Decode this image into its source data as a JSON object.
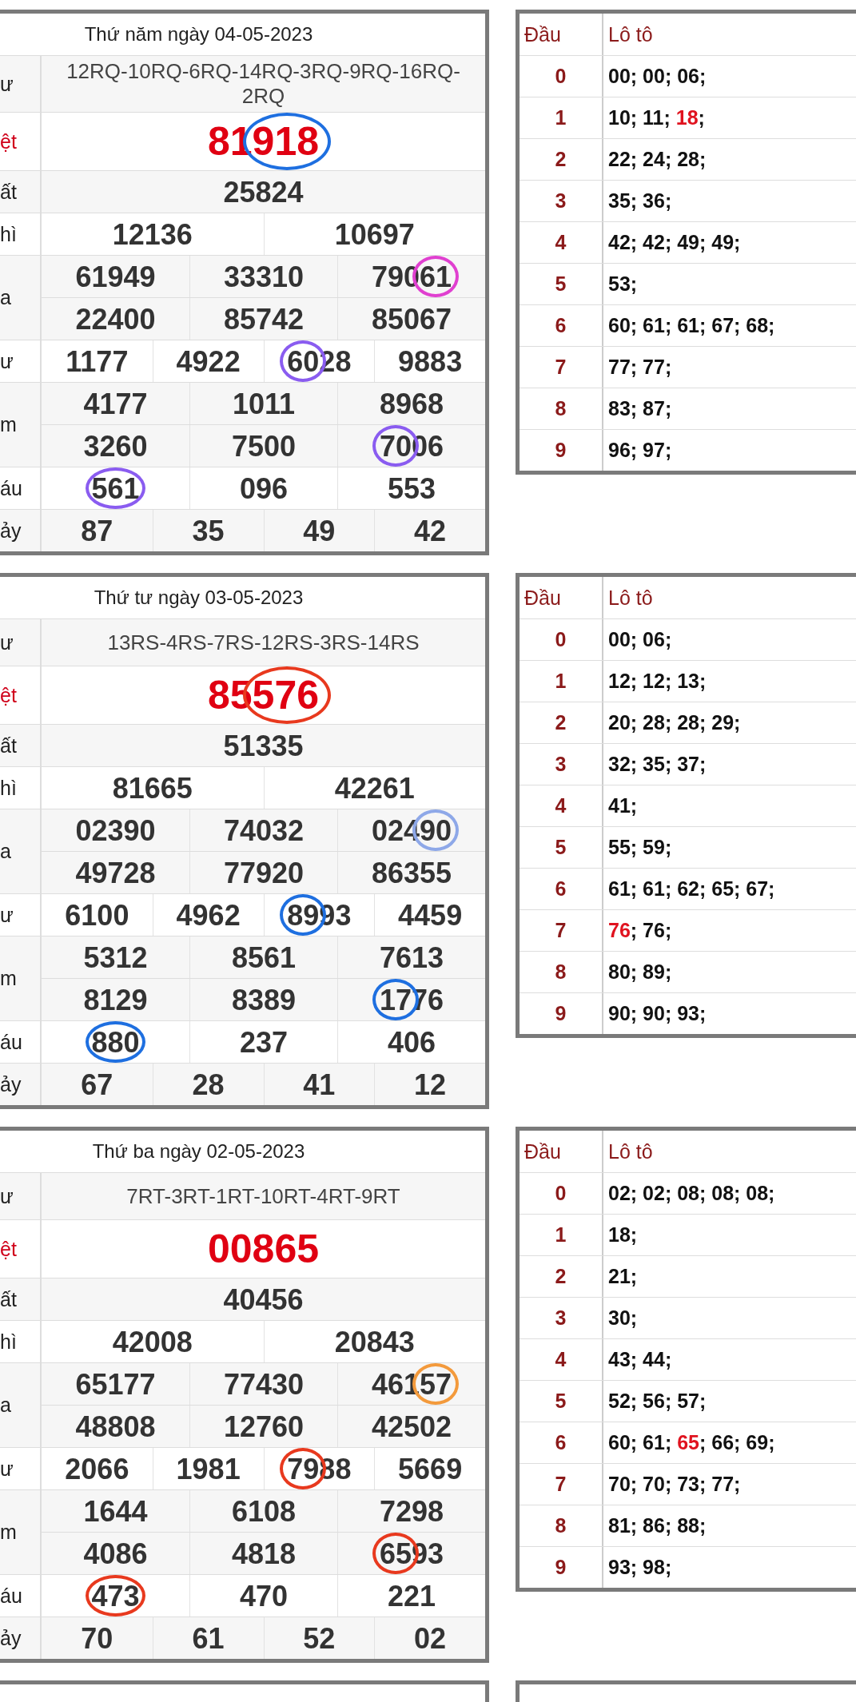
{
  "draws": [
    {
      "title": "Thứ năm ngày 04-05-2023",
      "rows": [
        {
          "label": "ư",
          "kind": "code",
          "lines": [
            [
              {
                "value": "12RQ-10RQ-6RQ-14RQ-3RQ-9RQ-16RQ-2RQ"
              }
            ]
          ]
        },
        {
          "label": "ệt",
          "kind": "special",
          "lines": [
            [
              {
                "value": "81918",
                "circle": {
                  "color": "#1e6fe0",
                  "kind": "end"
                }
              }
            ]
          ]
        },
        {
          "label": "ất",
          "kind": "prize",
          "lines": [
            [
              {
                "value": "25824"
              }
            ]
          ]
        },
        {
          "label": "hì",
          "kind": "prize",
          "lines": [
            [
              {
                "value": "12136"
              },
              {
                "value": "10697"
              }
            ]
          ]
        },
        {
          "label": "a",
          "kind": "prize",
          "lines": [
            [
              {
                "value": "61949"
              },
              {
                "value": "33310"
              },
              {
                "value": "79061",
                "circle": {
                  "color": "#e040d0",
                  "kind": "tail"
                }
              }
            ],
            [
              {
                "value": "22400"
              },
              {
                "value": "85742"
              },
              {
                "value": "85067"
              }
            ]
          ]
        },
        {
          "label": "ư",
          "kind": "prize",
          "lines": [
            [
              {
                "value": "1177"
              },
              {
                "value": "4922"
              },
              {
                "value": "6028",
                "circle": {
                  "color": "#8a5cf0",
                  "kind": "front"
                }
              },
              {
                "value": "9883"
              }
            ]
          ]
        },
        {
          "label": "m",
          "kind": "prize",
          "lines": [
            [
              {
                "value": "4177"
              },
              {
                "value": "1011"
              },
              {
                "value": "8968"
              }
            ],
            [
              {
                "value": "3260"
              },
              {
                "value": "7500"
              },
              {
                "value": "7006",
                "circle": {
                  "color": "#8a5cf0",
                  "kind": "front"
                }
              }
            ]
          ]
        },
        {
          "label": "áu",
          "kind": "prize",
          "lines": [
            [
              {
                "value": "561",
                "circle": {
                  "color": "#8a5cf0",
                  "kind": "whole"
                }
              },
              {
                "value": "096"
              },
              {
                "value": "553"
              }
            ]
          ]
        },
        {
          "label": "ảy",
          "kind": "prize",
          "lines": [
            [
              {
                "value": "87"
              },
              {
                "value": "35"
              },
              {
                "value": "49"
              },
              {
                "value": "42"
              }
            ]
          ]
        }
      ],
      "loto": {
        "headers": [
          "Đầu",
          "Lô tô"
        ],
        "rows": [
          {
            "head": "0",
            "segments": [
              {
                "text": "00; 00; 06;",
                "special": false
              }
            ]
          },
          {
            "head": "1",
            "segments": [
              {
                "text": "10; 11; ",
                "special": false
              },
              {
                "text": "18",
                "special": true
              },
              {
                "text": ";",
                "special": false
              }
            ]
          },
          {
            "head": "2",
            "segments": [
              {
                "text": "22; 24; 28;",
                "special": false
              }
            ]
          },
          {
            "head": "3",
            "segments": [
              {
                "text": "35; 36;",
                "special": false
              }
            ]
          },
          {
            "head": "4",
            "segments": [
              {
                "text": "42; 42; 49; 49;",
                "special": false
              }
            ]
          },
          {
            "head": "5",
            "segments": [
              {
                "text": "53;",
                "special": false
              }
            ]
          },
          {
            "head": "6",
            "segments": [
              {
                "text": "60; 61; 61; 67; 68;",
                "special": false
              }
            ]
          },
          {
            "head": "7",
            "segments": [
              {
                "text": "77; 77;",
                "special": false
              }
            ]
          },
          {
            "head": "8",
            "segments": [
              {
                "text": "83; 87;",
                "special": false
              }
            ]
          },
          {
            "head": "9",
            "segments": [
              {
                "text": "96; 97;",
                "special": false
              }
            ]
          }
        ]
      }
    },
    {
      "title": "Thứ tư ngày 03-05-2023",
      "rows": [
        {
          "label": "ư",
          "kind": "code",
          "lines": [
            [
              {
                "value": "13RS-4RS-7RS-12RS-3RS-14RS"
              }
            ]
          ]
        },
        {
          "label": "ệt",
          "kind": "special",
          "lines": [
            [
              {
                "value": "85576",
                "circle": {
                  "color": "#e8391e",
                  "kind": "end"
                }
              }
            ]
          ]
        },
        {
          "label": "ất",
          "kind": "prize",
          "lines": [
            [
              {
                "value": "51335"
              }
            ]
          ]
        },
        {
          "label": "hì",
          "kind": "prize",
          "lines": [
            [
              {
                "value": "81665"
              },
              {
                "value": "42261"
              }
            ]
          ]
        },
        {
          "label": "a",
          "kind": "prize",
          "lines": [
            [
              {
                "value": "02390"
              },
              {
                "value": "74032"
              },
              {
                "value": "02490",
                "circle": {
                  "color": "#8ea8e8",
                  "kind": "tail"
                }
              }
            ],
            [
              {
                "value": "49728"
              },
              {
                "value": "77920"
              },
              {
                "value": "86355"
              }
            ]
          ]
        },
        {
          "label": "ư",
          "kind": "prize",
          "lines": [
            [
              {
                "value": "6100"
              },
              {
                "value": "4962"
              },
              {
                "value": "8993",
                "circle": {
                  "color": "#1e6fe0",
                  "kind": "front"
                }
              },
              {
                "value": "4459"
              }
            ]
          ]
        },
        {
          "label": "m",
          "kind": "prize",
          "lines": [
            [
              {
                "value": "5312"
              },
              {
                "value": "8561"
              },
              {
                "value": "7613"
              }
            ],
            [
              {
                "value": "8129"
              },
              {
                "value": "8389"
              },
              {
                "value": "1776",
                "circle": {
                  "color": "#1e6fe0",
                  "kind": "front"
                }
              }
            ]
          ]
        },
        {
          "label": "áu",
          "kind": "prize",
          "lines": [
            [
              {
                "value": "880",
                "circle": {
                  "color": "#1e6fe0",
                  "kind": "whole"
                }
              },
              {
                "value": "237"
              },
              {
                "value": "406"
              }
            ]
          ]
        },
        {
          "label": "ảy",
          "kind": "prize",
          "lines": [
            [
              {
                "value": "67"
              },
              {
                "value": "28"
              },
              {
                "value": "41"
              },
              {
                "value": "12"
              }
            ]
          ]
        }
      ],
      "loto": {
        "headers": [
          "Đầu",
          "Lô tô"
        ],
        "rows": [
          {
            "head": "0",
            "segments": [
              {
                "text": "00; 06;",
                "special": false
              }
            ]
          },
          {
            "head": "1",
            "segments": [
              {
                "text": "12; 12; 13;",
                "special": false
              }
            ]
          },
          {
            "head": "2",
            "segments": [
              {
                "text": "20; 28; 28; 29;",
                "special": false
              }
            ]
          },
          {
            "head": "3",
            "segments": [
              {
                "text": "32; 35; 37;",
                "special": false
              }
            ]
          },
          {
            "head": "4",
            "segments": [
              {
                "text": "41;",
                "special": false
              }
            ]
          },
          {
            "head": "5",
            "segments": [
              {
                "text": "55; 59;",
                "special": false
              }
            ]
          },
          {
            "head": "6",
            "segments": [
              {
                "text": "61; 61; 62; 65; 67;",
                "special": false
              }
            ]
          },
          {
            "head": "7",
            "segments": [
              {
                "text": "76",
                "special": true
              },
              {
                "text": "; 76;",
                "special": false
              }
            ]
          },
          {
            "head": "8",
            "segments": [
              {
                "text": "80; 89;",
                "special": false
              }
            ]
          },
          {
            "head": "9",
            "segments": [
              {
                "text": "90; 90; 93;",
                "special": false
              }
            ]
          }
        ]
      }
    },
    {
      "title": "Thứ ba ngày 02-05-2023",
      "rows": [
        {
          "label": "ư",
          "kind": "code",
          "lines": [
            [
              {
                "value": "7RT-3RT-1RT-10RT-4RT-9RT"
              }
            ]
          ]
        },
        {
          "label": "ệt",
          "kind": "special",
          "lines": [
            [
              {
                "value": "00865"
              }
            ]
          ]
        },
        {
          "label": "ất",
          "kind": "prize",
          "lines": [
            [
              {
                "value": "40456"
              }
            ]
          ]
        },
        {
          "label": "hì",
          "kind": "prize",
          "lines": [
            [
              {
                "value": "42008"
              },
              {
                "value": "20843"
              }
            ]
          ]
        },
        {
          "label": "a",
          "kind": "prize",
          "lines": [
            [
              {
                "value": "65177"
              },
              {
                "value": "77430"
              },
              {
                "value": "46157",
                "circle": {
                  "color": "#f39a3c",
                  "kind": "tail"
                }
              }
            ],
            [
              {
                "value": "48808"
              },
              {
                "value": "12760"
              },
              {
                "value": "42502"
              }
            ]
          ]
        },
        {
          "label": "ư",
          "kind": "prize",
          "lines": [
            [
              {
                "value": "2066"
              },
              {
                "value": "1981"
              },
              {
                "value": "7988",
                "circle": {
                  "color": "#e8391e",
                  "kind": "front"
                }
              },
              {
                "value": "5669"
              }
            ]
          ]
        },
        {
          "label": "m",
          "kind": "prize",
          "lines": [
            [
              {
                "value": "1644"
              },
              {
                "value": "6108"
              },
              {
                "value": "7298"
              }
            ],
            [
              {
                "value": "4086"
              },
              {
                "value": "4818"
              },
              {
                "value": "6593",
                "circle": {
                  "color": "#e8391e",
                  "kind": "front"
                }
              }
            ]
          ]
        },
        {
          "label": "áu",
          "kind": "prize",
          "lines": [
            [
              {
                "value": "473",
                "circle": {
                  "color": "#e8391e",
                  "kind": "whole"
                }
              },
              {
                "value": "470"
              },
              {
                "value": "221"
              }
            ]
          ]
        },
        {
          "label": "ảy",
          "kind": "prize",
          "lines": [
            [
              {
                "value": "70"
              },
              {
                "value": "61"
              },
              {
                "value": "52"
              },
              {
                "value": "02"
              }
            ]
          ]
        }
      ],
      "loto": {
        "headers": [
          "Đầu",
          "Lô tô"
        ],
        "rows": [
          {
            "head": "0",
            "segments": [
              {
                "text": "02; 02; 08; 08; 08;",
                "special": false
              }
            ]
          },
          {
            "head": "1",
            "segments": [
              {
                "text": "18;",
                "special": false
              }
            ]
          },
          {
            "head": "2",
            "segments": [
              {
                "text": "21;",
                "special": false
              }
            ]
          },
          {
            "head": "3",
            "segments": [
              {
                "text": "30;",
                "special": false
              }
            ]
          },
          {
            "head": "4",
            "segments": [
              {
                "text": "43; 44;",
                "special": false
              }
            ]
          },
          {
            "head": "5",
            "segments": [
              {
                "text": "52; 56; 57;",
                "special": false
              }
            ]
          },
          {
            "head": "6",
            "segments": [
              {
                "text": "60; 61; ",
                "special": false
              },
              {
                "text": "65",
                "special": true
              },
              {
                "text": "; 66; 69;",
                "special": false
              }
            ]
          },
          {
            "head": "7",
            "segments": [
              {
                "text": "70; 70; 73; 77;",
                "special": false
              }
            ]
          },
          {
            "head": "8",
            "segments": [
              {
                "text": "81; 86; 88;",
                "special": false
              }
            ]
          },
          {
            "head": "9",
            "segments": [
              {
                "text": "93; 98;",
                "special": false
              }
            ]
          }
        ]
      }
    }
  ]
}
